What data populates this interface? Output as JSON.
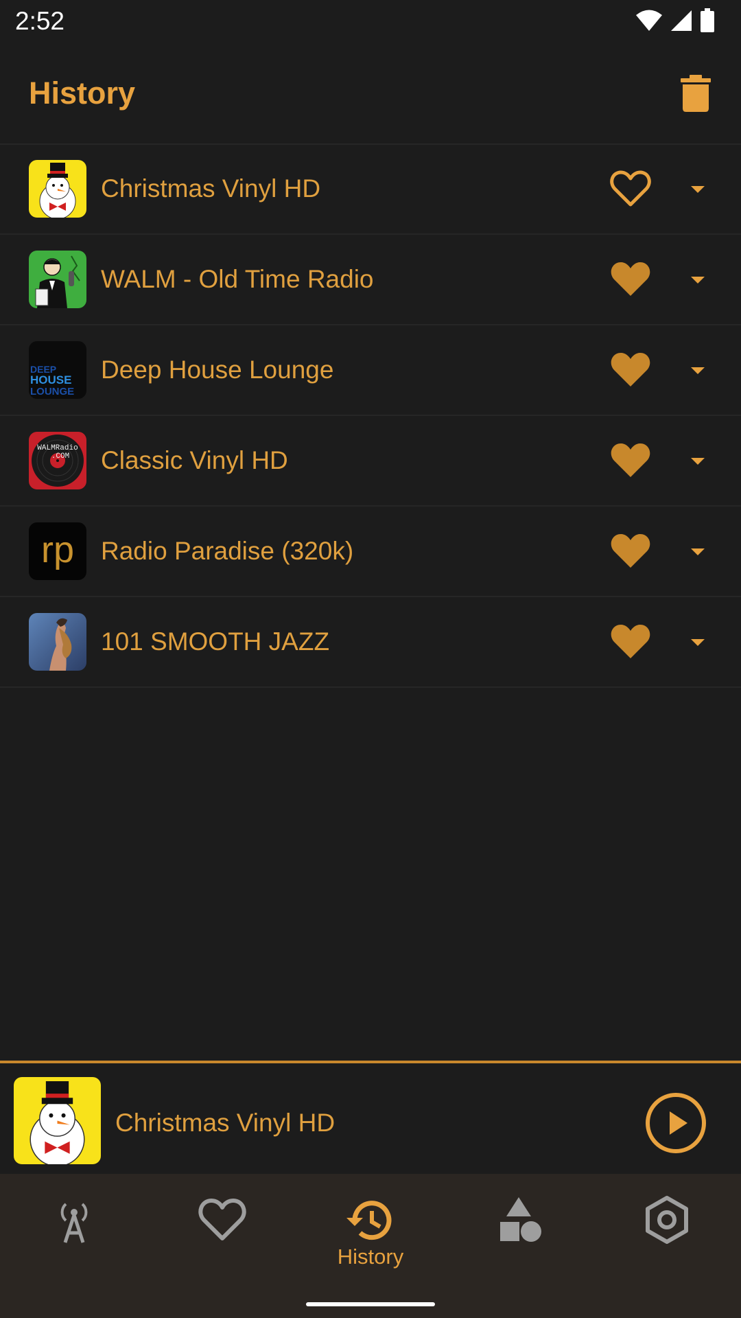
{
  "status_bar": {
    "time": "2:52"
  },
  "header": {
    "title": "History"
  },
  "stations": [
    {
      "name": "Christmas Vinyl HD",
      "favorite": false,
      "logo": "snowman"
    },
    {
      "name": "WALM - Old Time Radio",
      "favorite": true,
      "logo": "old-time-announcer"
    },
    {
      "name": "Deep House Lounge",
      "favorite": true,
      "logo_text": [
        "DEEP",
        "HOUSE",
        "LOUNGE"
      ]
    },
    {
      "name": "Classic Vinyl HD",
      "favorite": true,
      "logo_text": [
        "WALMRadio",
        ".COM"
      ]
    },
    {
      "name": "Radio Paradise (320k)",
      "favorite": true,
      "logo_text": [
        "rp"
      ]
    },
    {
      "name": "101 SMOOTH JAZZ",
      "favorite": true,
      "logo": "saxophone-player"
    }
  ],
  "player": {
    "station_name": "Christmas Vinyl HD",
    "state": "paused"
  },
  "bottom_nav": {
    "items": [
      {
        "icon": "radio-tower-icon",
        "label": "",
        "active": false
      },
      {
        "icon": "heart-icon",
        "label": "",
        "active": false
      },
      {
        "icon": "history-icon",
        "label": "History",
        "active": true
      },
      {
        "icon": "shapes-icon",
        "label": "",
        "active": false
      },
      {
        "icon": "settings-icon",
        "label": "",
        "active": false
      }
    ]
  },
  "colors": {
    "accent": "#e8a23f",
    "favorite": "#c8882c",
    "background": "#1c1c1c",
    "nav_background": "#2b2622",
    "inactive_icon": "#9e9e9e"
  }
}
